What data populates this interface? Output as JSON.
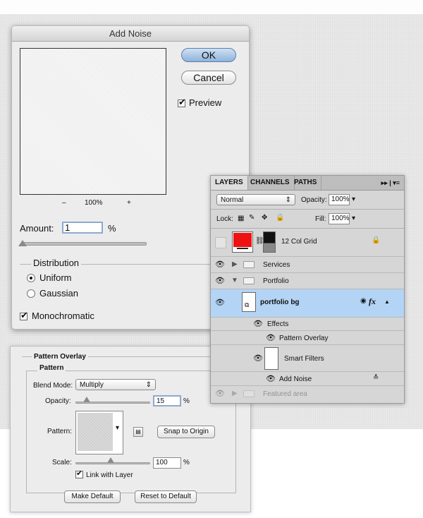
{
  "add_noise": {
    "title": "Add Noise",
    "ok_label": "OK",
    "cancel_label": "Cancel",
    "preview_label": "Preview",
    "preview_checked": true,
    "zoom_minus": "–",
    "zoom_value": "100%",
    "zoom_plus": "+",
    "amount_label": "Amount:",
    "amount_value": "1",
    "amount_unit": "%",
    "amount_slider_fraction": 0.01,
    "distribution_label": "Distribution",
    "uniform_label": "Uniform",
    "gaussian_label": "Gaussian",
    "selected_distribution": "Uniform",
    "monochromatic_label": "Monochromatic",
    "monochromatic_checked": true
  },
  "layers_panel": {
    "tabs": [
      "LAYERS",
      "CHANNELS",
      "PATHS"
    ],
    "active_tab": "LAYERS",
    "menu_glyph": "▸▸ | ▾≡",
    "blend_mode": "Normal",
    "opacity_label": "Opacity:",
    "opacity_value": "100%",
    "lock_label": "Lock:",
    "fill_label": "Fill:",
    "fill_value": "100%",
    "layers": [
      {
        "name": "12 Col Grid",
        "kind": "layer",
        "visible": false,
        "locked": true
      },
      {
        "name": "Services",
        "kind": "group",
        "visible": true,
        "expanded": false
      },
      {
        "name": "Portfolio",
        "kind": "group",
        "visible": true,
        "expanded": true
      },
      {
        "name": "portfolio bg",
        "kind": "smart-object",
        "visible": true,
        "selected": true,
        "fx_label": "fx"
      },
      {
        "name": "Effects",
        "kind": "effects-header",
        "visible": true
      },
      {
        "name": "Pattern Overlay",
        "kind": "effect",
        "visible": true
      },
      {
        "name": "Smart Filters",
        "kind": "smart-filters",
        "visible": true
      },
      {
        "name": "Add Noise",
        "kind": "filter",
        "visible": true
      },
      {
        "name": "Featured area",
        "kind": "group",
        "visible": true,
        "expanded": false
      }
    ],
    "accent_selected": "#b3d4f5",
    "grid_thumb_color": "#ee1111"
  },
  "pattern_overlay": {
    "outer_title": "Pattern Overlay",
    "inner_title": "Pattern",
    "blend_mode_label": "Blend Mode:",
    "blend_mode_value": "Multiply",
    "opacity_label": "Opacity:",
    "opacity_value": "15",
    "opacity_unit": "%",
    "opacity_fraction": 0.15,
    "pattern_label": "Pattern:",
    "snap_label": "Snap to Origin",
    "scale_label": "Scale:",
    "scale_value": "100",
    "scale_unit": "%",
    "link_label": "Link with Layer",
    "link_checked": true,
    "make_default_label": "Make Default",
    "reset_default_label": "Reset to Default"
  }
}
